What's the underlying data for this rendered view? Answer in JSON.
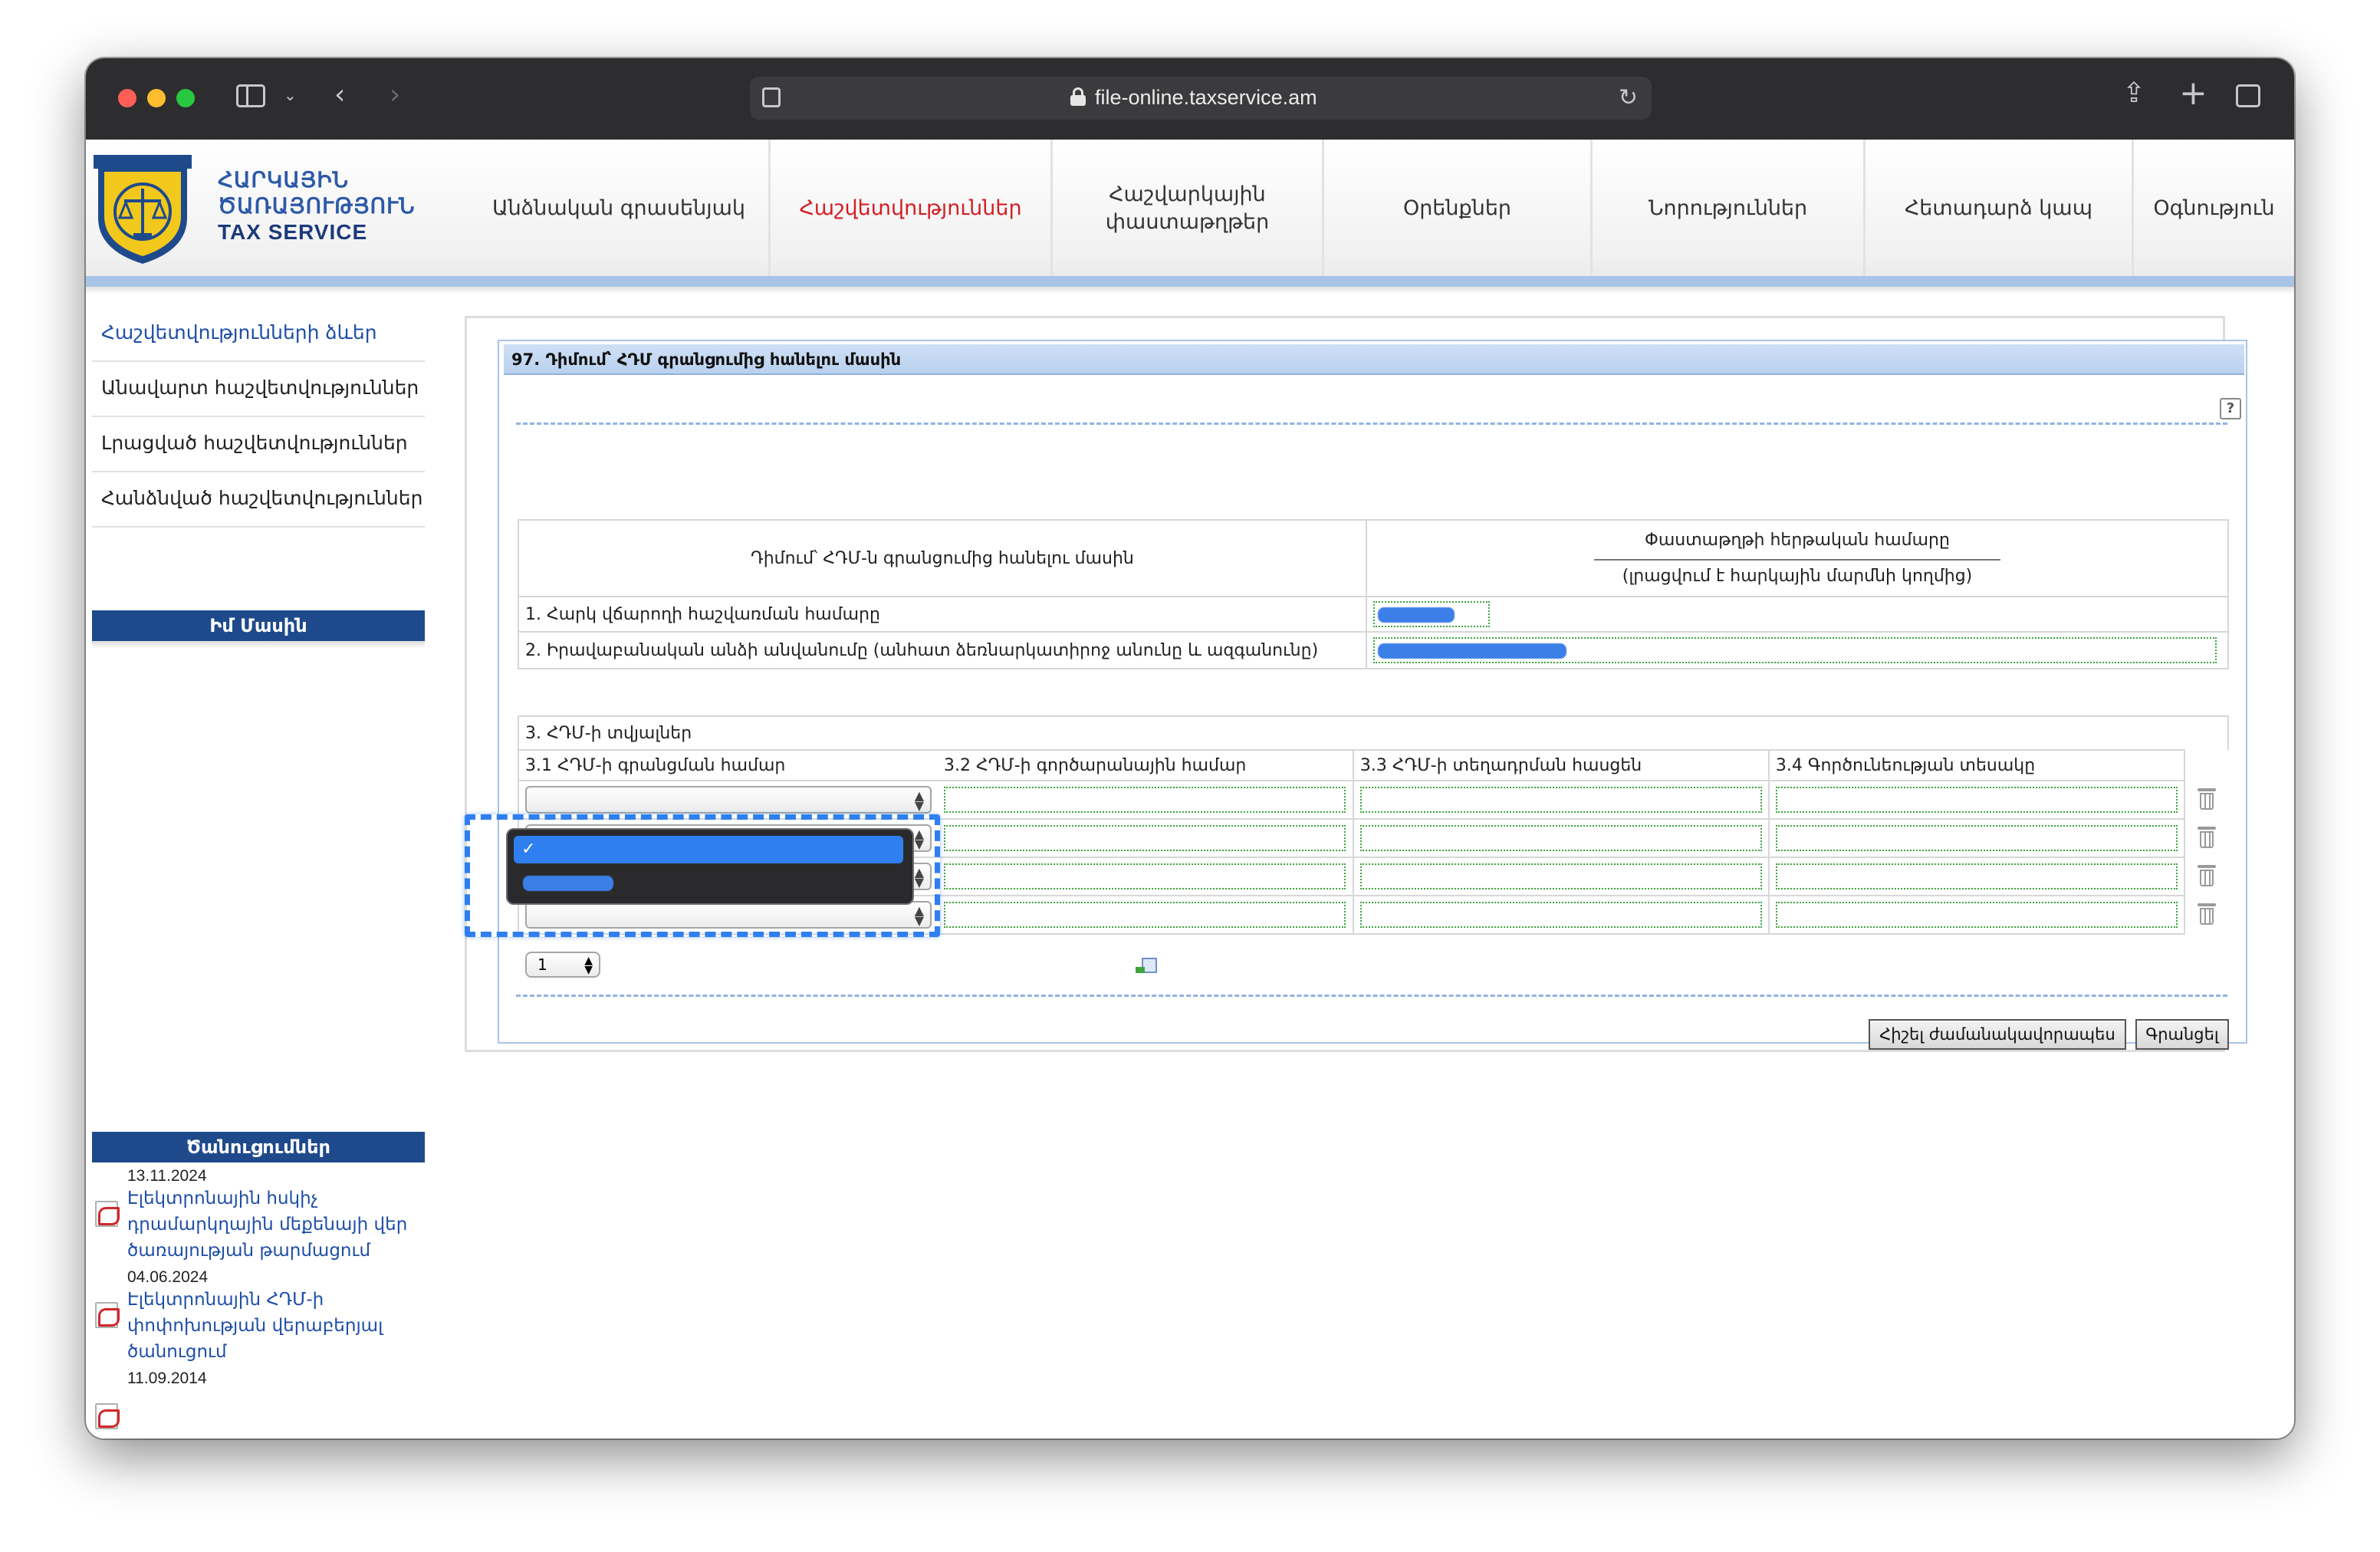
{
  "browser": {
    "url": "file-online.taxservice.am"
  },
  "site": {
    "logo_line1": "ՀԱՐԿԱՅԻՆ",
    "logo_line2": "ԾԱՌԱՅՈՒԹՅՈՒՆ",
    "logo_line3": "TAX SERVICE",
    "nav": [
      {
        "label": "Անձնական գրասենյակ"
      },
      {
        "label": "Հաշվետվություններ"
      },
      {
        "label": "Հաշվարկային փաստաթղթեր"
      },
      {
        "label": "Օրենքներ"
      },
      {
        "label": "Նորություններ"
      },
      {
        "label": "Հետադարձ կապ"
      },
      {
        "label": "Օգնություն"
      }
    ]
  },
  "sidebar": {
    "menu": [
      {
        "label": "Հաշվետվությունների ձևեր"
      },
      {
        "label": "Անավարտ հաշվետվություններ"
      },
      {
        "label": "Լրացված հաշվետվություններ"
      },
      {
        "label": "Հանձնված հաշվետվություններ"
      }
    ],
    "about_title": "Իմ Մասին",
    "news_title": "Ծանուցումներ",
    "news": [
      {
        "date": "13.11.2024",
        "text": "Էլեկտրոնային հսկիչ դրամարկղային մեքենայի վեր ծառայության թարմացում"
      },
      {
        "date": "04.06.2024",
        "text": "Էլեկտրոնային ՀԴՄ-ի փոփոխության վերաբերյալ ծանուցում"
      },
      {
        "date": "11.09.2014",
        "text": ""
      }
    ]
  },
  "form": {
    "title": "97. Դիմում՝ ՀԴՄ գրանցումից հանելու մասին",
    "header_left": "Դիմում՝ ՀԴՄ-ն գրանցումից հանելու մասին",
    "doc_number_label": "Փաստաթղթի հերթական համարը",
    "doc_number_note": "(լրացվում է հարկային մարմնի կողմից)",
    "row1_label": "1. Հարկ վճարողի հաշվառման համարը",
    "row2_label": "2. Իրավաբանական անձի անվանումը (անհատ ձեռնարկատիրոջ անունը և ազգանունը)",
    "section3_title": "3. ՀԴՄ-ի տվյալներ",
    "col_3_1": "3.1 ՀԴՄ-ի գրանցման համար",
    "col_3_2": "3.2 ՀԴՄ-ի գործարանային համար",
    "col_3_3": "3.3 ՀԴՄ-ի տեղադրման հասցեն",
    "col_3_4": "3.4 Գործունեության տեսակը",
    "page_value": "1",
    "btn_save_draft": "Հիշել ժամանակավորապես",
    "btn_save": "Գրանցել",
    "dropdown_selected_mark": "✓"
  },
  "colors": {
    "accent": "#1e4a8c",
    "nav_active": "#d21f24",
    "link": "#1e4ea8",
    "highlight": "#2f7ff0"
  }
}
